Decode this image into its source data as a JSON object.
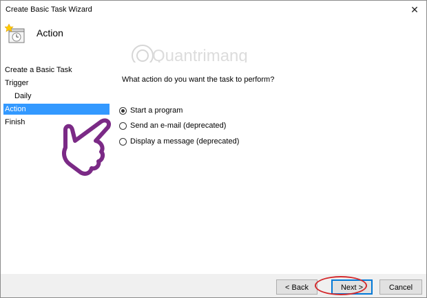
{
  "window": {
    "title": "Create Basic Task Wizard",
    "close_glyph": "✕"
  },
  "header": {
    "title": "Action",
    "icon": "task-scheduler-icon",
    "watermark": "Quantrimang"
  },
  "nav": {
    "items": [
      {
        "label": "Create a Basic Task",
        "selected": false,
        "sub": false
      },
      {
        "label": "Trigger",
        "selected": false,
        "sub": false
      },
      {
        "label": "Daily",
        "selected": false,
        "sub": true
      },
      {
        "label": "Action",
        "selected": true,
        "sub": false
      },
      {
        "label": "Finish",
        "selected": false,
        "sub": false
      }
    ]
  },
  "content": {
    "question": "What action do you want the task to perform?",
    "options": [
      {
        "label": "Start a program",
        "checked": true
      },
      {
        "label": "Send an e-mail (deprecated)",
        "checked": false
      },
      {
        "label": "Display a message (deprecated)",
        "checked": false
      }
    ]
  },
  "buttons": {
    "back": "< Back",
    "next": "Next >",
    "cancel": "Cancel"
  },
  "colors": {
    "selection": "#3399ff",
    "highlight": "#d4282b",
    "hand": "#7b2a86"
  }
}
